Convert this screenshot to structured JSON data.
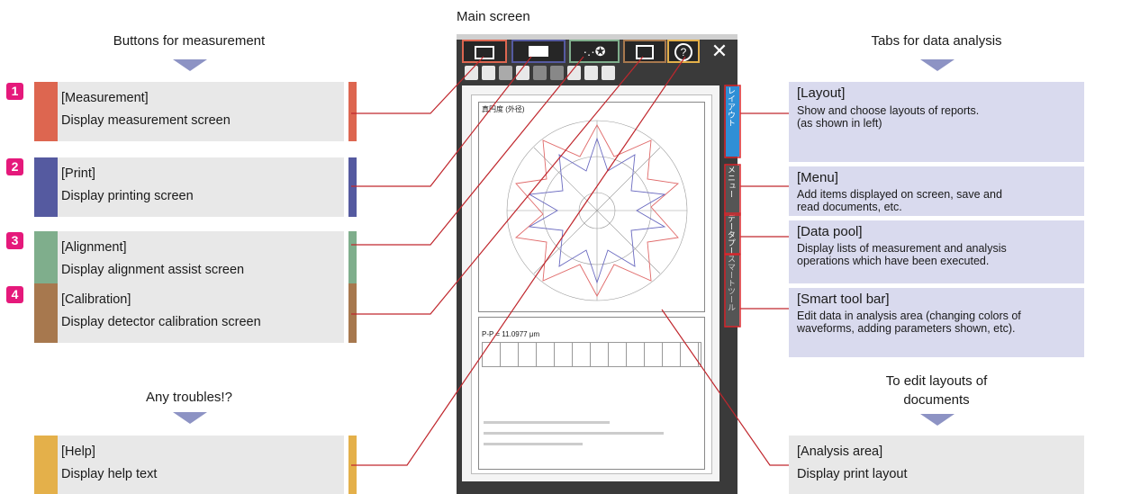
{
  "main_screen_title": "Main screen",
  "left": {
    "heading": "Buttons for measurement",
    "buttons": [
      {
        "num": "1",
        "title": "[Measurement]",
        "desc": "Display measurement screen",
        "color": "#dd6650"
      },
      {
        "num": "2",
        "title": "[Print]",
        "desc": "Display printing screen",
        "color": "#555aa0"
      },
      {
        "num": "3",
        "title": "[Alignment]",
        "desc": "Display alignment assist screen",
        "color": "#7fae8c"
      },
      {
        "num": "4",
        "title": "[Calibration]",
        "desc": "Display detector calibration screen",
        "color": "#a7784e"
      }
    ],
    "help_heading": "Any troubles!?",
    "help": {
      "title": "[Help]",
      "desc": "Display help text",
      "color": "#e4b04a"
    }
  },
  "right": {
    "heading": "Tabs for data analysis",
    "tabs": [
      {
        "title": "[Layout]",
        "desc": [
          "Show and choose layouts of reports.",
          "(as shown in left)"
        ]
      },
      {
        "title": "[Menu]",
        "desc": [
          "Add items displayed on screen, save and",
          "read documents, etc."
        ]
      },
      {
        "title": "[Data pool]",
        "desc": [
          "Display lists of measurement and analysis",
          "operations which have been executed."
        ]
      },
      {
        "title": "[Smart tool bar]",
        "desc": [
          "Edit data in analysis area (changing colors of",
          "waveforms, adding parameters shown, etc)."
        ]
      }
    ],
    "edit_heading": [
      "To edit layouts of",
      "documents"
    ],
    "analysis": {
      "title": "[Analysis area]",
      "desc": "Display print layout"
    }
  },
  "screen": {
    "close_glyph": "✕",
    "help_glyph": "?",
    "align_glyph": "·.·✪",
    "vtab_labels": [
      "レイアウト",
      "メニュー",
      "データプール",
      "スマートツール"
    ],
    "doc_heading": "真円度 (外径)",
    "doc_value": "P-P = 11.0977 μm"
  },
  "colors": {
    "accent_magenta": "#e5197b",
    "arrow": "#8d93c4",
    "connector": "#c0272d"
  }
}
